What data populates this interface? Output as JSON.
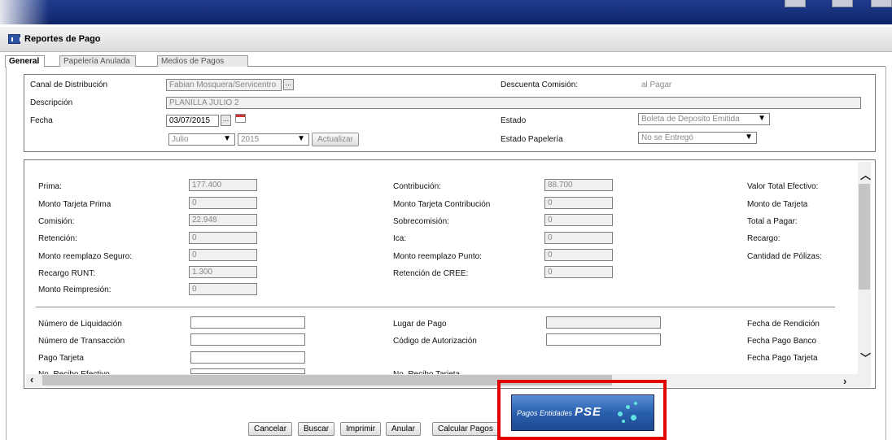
{
  "window": {
    "title": "Reportes de Pago"
  },
  "tabs": [
    {
      "label": "General",
      "active": true
    },
    {
      "label": "Papelería Anulada",
      "active": false
    },
    {
      "label": "Medios de Pagos",
      "active": false
    }
  ],
  "header": {
    "canal_label": "Canal de Distribución",
    "canal_value": "Fabian Mosquera/Servicentro",
    "descuenta_label": "Descuenta Comisión:",
    "descuenta_value": "al Pagar",
    "descripcion_label": "Descripción",
    "descripcion_value": "PLANILLA JULIO 2",
    "fecha_label": "Fecha",
    "fecha_value": "03/07/2015",
    "estado_label": "Estado",
    "estado_value": "Boleta de Deposito Emitida",
    "mes_value": "Julio",
    "anio_value": "2015",
    "actualizar_label": "Actualizar",
    "estado_papeleria_label": "Estado Papelería",
    "estado_papeleria_value": "No se Entregó",
    "dots_label": "..."
  },
  "totals": {
    "col1": [
      {
        "label": "Prima:",
        "value": "177.400"
      },
      {
        "label": "Monto Tarjeta Prima",
        "value": "0"
      },
      {
        "label": "Comisión:",
        "value": "22.948"
      },
      {
        "label": "Retención:",
        "value": "0"
      },
      {
        "label": "Monto reemplazo Seguro:",
        "value": "0"
      },
      {
        "label": "Recargo RUNT:",
        "value": "1.300"
      },
      {
        "label": "Monto Reimpresión:",
        "value": "0"
      }
    ],
    "col2": [
      {
        "label": "Contribución:",
        "value": "88.700"
      },
      {
        "label": "Monto Tarjeta Contribución",
        "value": "0"
      },
      {
        "label": "Sobrecomisión:",
        "value": "0"
      },
      {
        "label": "Ica:",
        "value": "0"
      },
      {
        "label": "Monto reemplazo Punto:",
        "value": "0"
      },
      {
        "label": "Retención de CREE:",
        "value": "0"
      }
    ],
    "col3": [
      {
        "label": "Valor Total Efectivo:"
      },
      {
        "label": "Monto de Tarjeta"
      },
      {
        "label": "Total a Pagar:"
      },
      {
        "label": "Recargo:"
      },
      {
        "label": "Cantidad de Pólizas:"
      }
    ]
  },
  "liquidacion": {
    "col1": [
      "Número de Liquidación",
      "Número de Transacción",
      "Pago Tarjeta",
      "No. Recibo Efectivo"
    ],
    "col2": [
      "Lugar de Pago",
      "Código de Autorización",
      "",
      "No. Recibo Tarjeta"
    ],
    "col3": [
      "Fecha de Rendición",
      "Fecha Pago Banco",
      "Fecha Pago Tarjeta"
    ]
  },
  "buttons": {
    "cancelar": "Cancelar",
    "buscar": "Buscar",
    "imprimir": "Imprimir",
    "anular": "Anular",
    "calcular": "Calcular Pagos"
  },
  "pse": {
    "prefix": "Pagos Entidades",
    "brand": "PSE"
  },
  "colors": {
    "titlebar": "#1f3b8c",
    "highlight": "#e00000",
    "pse_button": "#2a5fae"
  }
}
